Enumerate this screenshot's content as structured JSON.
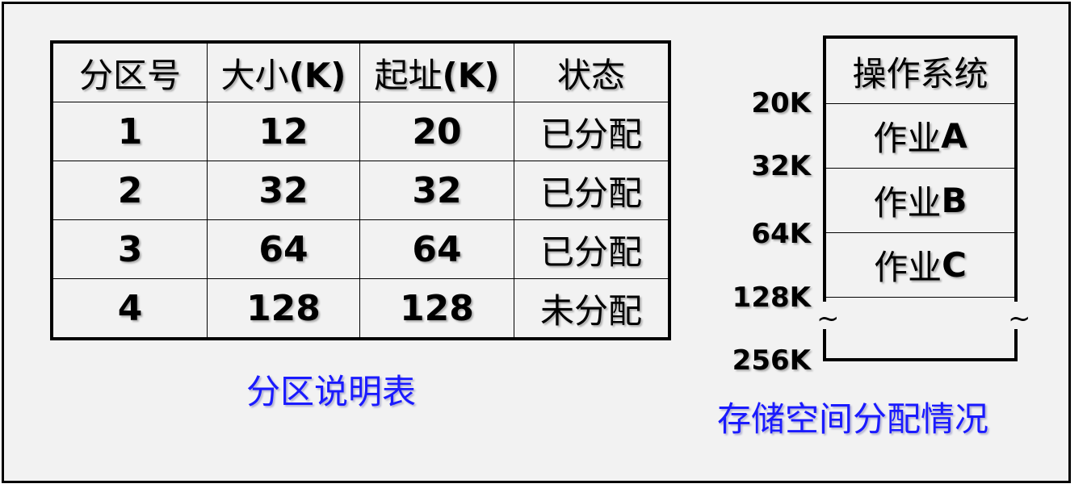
{
  "table": {
    "headers": [
      {
        "text": "分区号",
        "suffix": ""
      },
      {
        "text": "大小",
        "suffix": "(K)"
      },
      {
        "text": "起址",
        "suffix": "(K)"
      },
      {
        "text": "状态",
        "suffix": ""
      }
    ],
    "rows": [
      {
        "id": "1",
        "size": "12",
        "start": "20",
        "status": "已分配"
      },
      {
        "id": "2",
        "size": "32",
        "start": "32",
        "status": "已分配"
      },
      {
        "id": "3",
        "size": "64",
        "start": "64",
        "status": "已分配"
      },
      {
        "id": "4",
        "size": "128",
        "start": "128",
        "status": "未分配"
      }
    ],
    "caption": "分区说明表"
  },
  "memory": {
    "blocks": [
      {
        "prefix": "操作系统",
        "suffix": ""
      },
      {
        "prefix": "作业",
        "suffix": "A"
      },
      {
        "prefix": "作业",
        "suffix": "B"
      },
      {
        "prefix": "作业",
        "suffix": "C"
      }
    ],
    "addresses": [
      "20K",
      "32K",
      "64K",
      "128K",
      "256K"
    ],
    "break_symbol": "~",
    "caption": "存储空间分配情况"
  },
  "colors": {
    "caption": "#1a1aff",
    "background": "#f2f2f2",
    "border": "#000000"
  }
}
